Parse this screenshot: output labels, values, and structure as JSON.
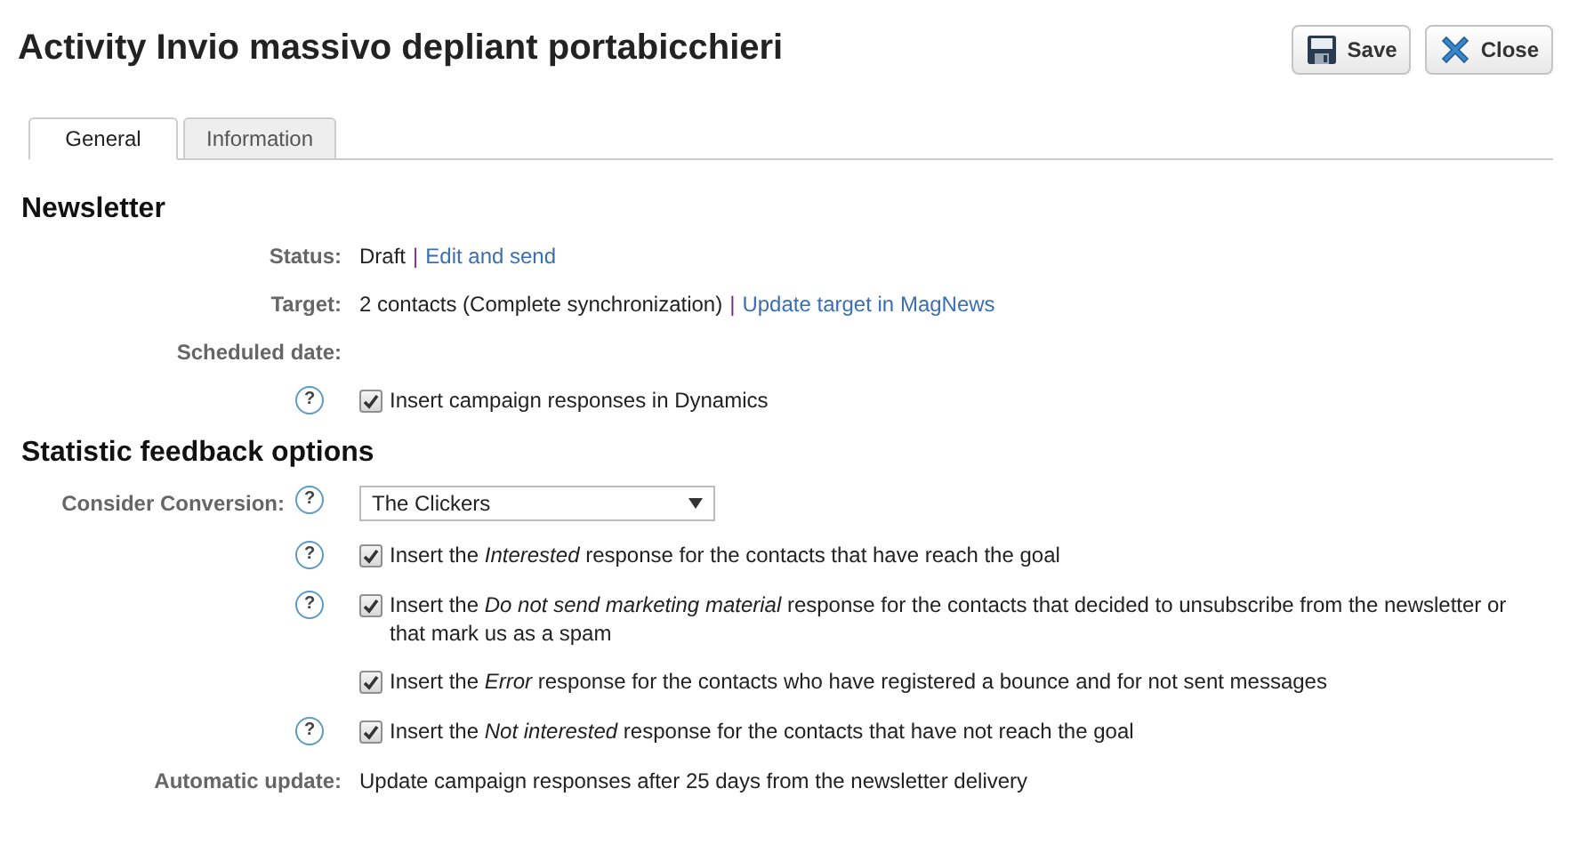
{
  "title": "Activity Invio massivo depliant portabicchieri",
  "buttons": [
    {
      "kind": "save",
      "label": "Save"
    },
    {
      "kind": "close",
      "label": "Close"
    }
  ],
  "tabs": [
    {
      "label": "General",
      "selected": true
    },
    {
      "label": "Information",
      "selected": false
    }
  ],
  "sections": [
    {
      "heading": "Newsletter",
      "rows": [
        {
          "kind": "field",
          "label": "Status:",
          "parts": [
            {
              "kind": "text",
              "text": "Draft"
            },
            {
              "kind": "sep",
              "text": "|"
            },
            {
              "kind": "link",
              "text": "Edit and send"
            }
          ]
        },
        {
          "kind": "field",
          "label": "Target:",
          "parts": [
            {
              "kind": "text",
              "text": "2 contacts (Complete synchronization)"
            },
            {
              "kind": "sep",
              "text": "|"
            },
            {
              "kind": "link",
              "text": "Update target in MagNews"
            }
          ]
        },
        {
          "kind": "field",
          "label": "Scheduled date:",
          "parts": []
        },
        {
          "kind": "check",
          "help": "?",
          "checked": true,
          "text": "Insert campaign responses in Dynamics"
        }
      ]
    },
    {
      "heading": "Statistic feedback options",
      "rows": [
        {
          "kind": "select",
          "label": "Consider Conversion:",
          "help": "?",
          "value": "The Clickers"
        },
        {
          "kind": "check",
          "help": "?",
          "checked": true,
          "text": "Insert the *Interested* response for the contacts that have reach the goal"
        },
        {
          "kind": "check",
          "help": "?",
          "checked": true,
          "text": "Insert the *Do not send marketing material* response for the contacts that decided to unsubscribe from the newsletter or that mark us as a spam"
        },
        {
          "kind": "check",
          "checked": true,
          "text": "Insert the *Error* response for the contacts who have registered a bounce and for not sent messages"
        },
        {
          "kind": "check",
          "help": "?",
          "checked": true,
          "text": "Insert the *Not interested* response for the contacts that have not reach the goal"
        },
        {
          "kind": "field",
          "label": "Automatic update:",
          "parts": [
            {
              "kind": "text",
              "text": "Update campaign responses after 25 days from the newsletter delivery"
            }
          ]
        }
      ]
    }
  ]
}
